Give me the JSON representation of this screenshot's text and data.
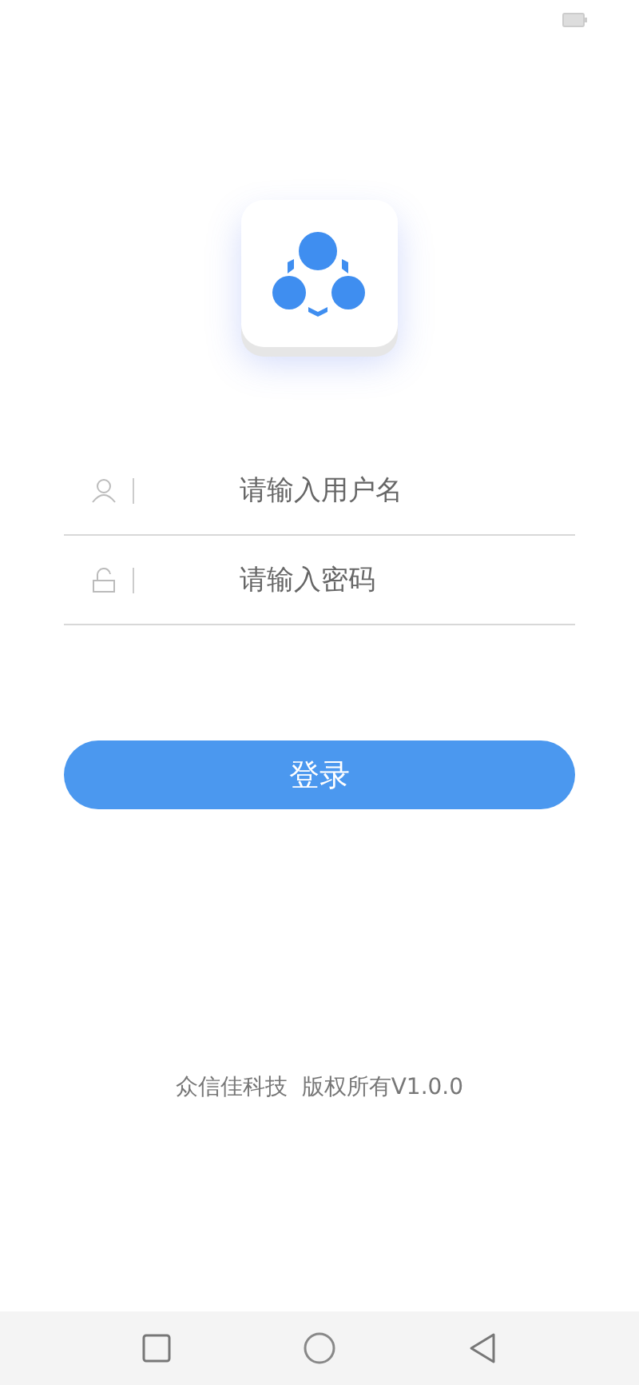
{
  "fields": [
    {
      "kind": "user",
      "placeholder": "请输入用户名"
    },
    {
      "kind": "lock",
      "placeholder": "请输入密码"
    }
  ],
  "login_button": "登录",
  "footer": "众信佳科技  版权所有V1.0.0"
}
